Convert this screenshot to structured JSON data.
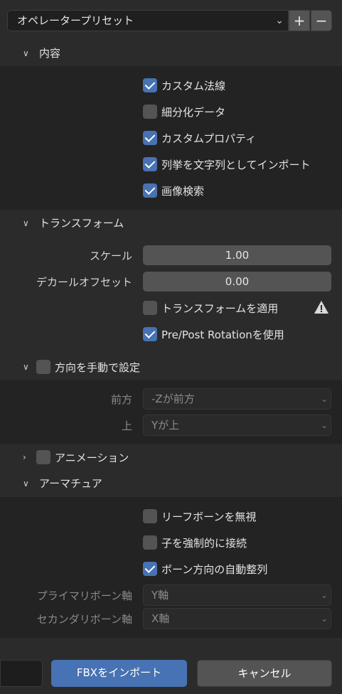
{
  "preset": {
    "label": "オペレータープリセット",
    "add": "+",
    "remove": "−"
  },
  "content": {
    "title": "内容",
    "items": [
      {
        "label": "カスタム法線",
        "checked": true
      },
      {
        "label": "細分化データ",
        "checked": false
      },
      {
        "label": "カスタムプロパティ",
        "checked": true
      },
      {
        "label": "列挙を文字列としてインポート",
        "checked": true
      },
      {
        "label": "画像検索",
        "checked": true
      }
    ]
  },
  "transform": {
    "title": "トランスフォーム",
    "scale_label": "スケール",
    "scale_value": "1.00",
    "decal_label": "デカールオフセット",
    "decal_value": "0.00",
    "apply_label": "トランスフォームを適用",
    "apply_checked": false,
    "prepost_label": "Pre/Post Rotationを使用",
    "prepost_checked": true
  },
  "orientation": {
    "title": "方向を手動で設定",
    "enabled": false,
    "forward_label": "前方",
    "forward_value": "-Zが前方",
    "up_label": "上",
    "up_value": "Yが上"
  },
  "animation": {
    "title": "アニメーション",
    "enabled": false
  },
  "armature": {
    "title": "アーマチュア",
    "items": [
      {
        "label": "リーフボーンを無視",
        "checked": false
      },
      {
        "label": "子を強制的に接続",
        "checked": false
      },
      {
        "label": "ボーン方向の自動整列",
        "checked": true
      }
    ],
    "primary_label": "プライマリボーン軸",
    "primary_value": "Y軸",
    "secondary_label": "セカンダリボーン軸",
    "secondary_value": "X軸"
  },
  "footer": {
    "import_label": "FBXをインポート",
    "cancel_label": "キャンセル"
  },
  "colors": {
    "accent": "#4772b3",
    "panel": "#2b2b2b",
    "panel_dark": "#232323"
  }
}
